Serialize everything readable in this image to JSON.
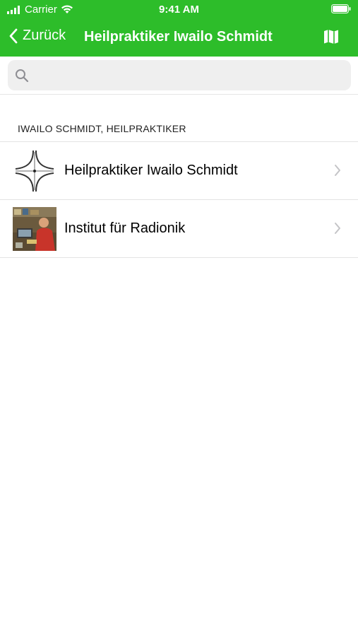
{
  "status_bar": {
    "carrier": "Carrier",
    "time": "9:41 AM"
  },
  "nav": {
    "back_label": "Zurück",
    "title": "Heilpraktiker Iwailo Schmidt"
  },
  "search": {
    "placeholder": ""
  },
  "section": {
    "header": "IWAILO SCHMIDT, HEILPRAKTIKER"
  },
  "items": [
    {
      "label": "Heilpraktiker Iwailo Schmidt",
      "thumbnail": "crossroads-logo"
    },
    {
      "label": "Institut für Radionik",
      "thumbnail": "photo-person-at-desk"
    }
  ],
  "colors": {
    "accent": "#2dbd2a"
  }
}
